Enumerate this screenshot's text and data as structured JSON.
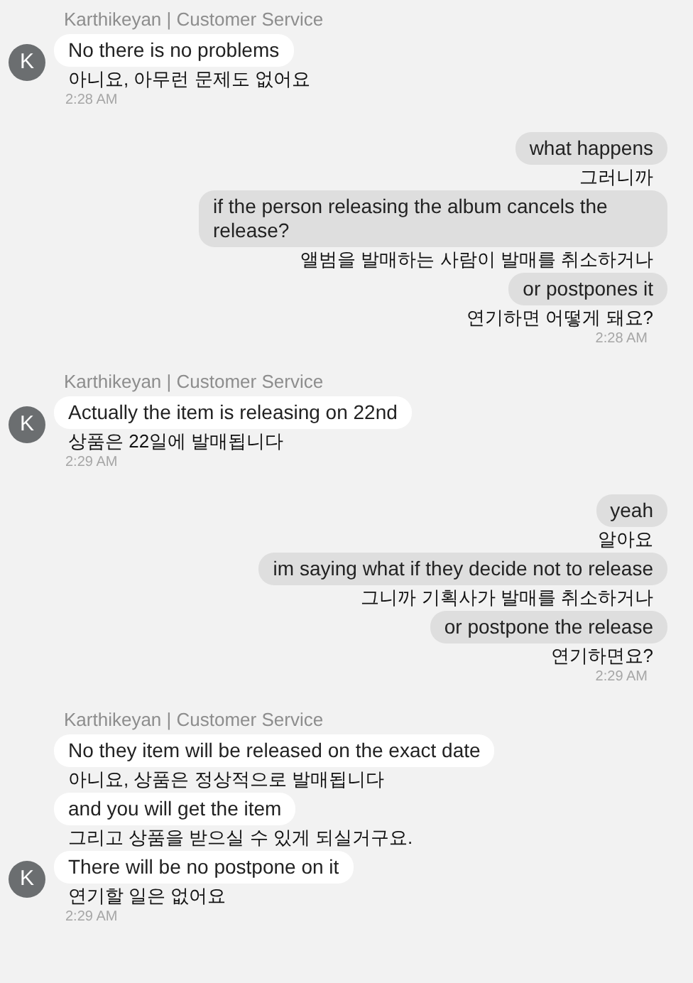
{
  "conversation": [
    {
      "kind": "agent",
      "name": "Karthikeyan | Customer Service",
      "avatar": "K",
      "time": "2:28 AM",
      "messages": [
        {
          "text": "No there is no problems",
          "translation": "아니요, 아무런 문제도 없어요"
        }
      ]
    },
    {
      "kind": "customer",
      "time": "2:28 AM",
      "messages": [
        {
          "text": "what happens",
          "translation": "그러니까"
        },
        {
          "text": "if the person releasing the album cancels the release?",
          "translation": "앨범을 발매하는 사람이 발매를 취소하거나"
        },
        {
          "text": "or postpones it",
          "translation": "연기하면 어떻게 돼요?"
        }
      ]
    },
    {
      "kind": "agent",
      "name": "Karthikeyan | Customer Service",
      "avatar": "K",
      "time": "2:29 AM",
      "messages": [
        {
          "text": "Actually the item is releasing on 22nd",
          "translation": "상품은 22일에 발매됩니다"
        }
      ]
    },
    {
      "kind": "customer",
      "time": "2:29 AM",
      "messages": [
        {
          "text": "yeah",
          "translation": "알아요"
        },
        {
          "text": "im saying what if they decide not to release",
          "translation": "그니까 기획사가 발매를 취소하거나"
        },
        {
          "text": "or postpone the release",
          "translation": "연기하면요?"
        }
      ]
    },
    {
      "kind": "agent",
      "name": "Karthikeyan | Customer Service",
      "avatar": "K",
      "time": "2:29 AM",
      "messages": [
        {
          "text": "No they item will be released on the exact date",
          "translation": "아니요, 상품은 정상적으로 발매됩니다"
        },
        {
          "text": "and you will get the item",
          "translation": "그리고 상품을 받으실 수 있게 되실거구요."
        },
        {
          "text": "There will be no postpone on it",
          "translation": "연기할 일은 없어요"
        }
      ]
    }
  ]
}
